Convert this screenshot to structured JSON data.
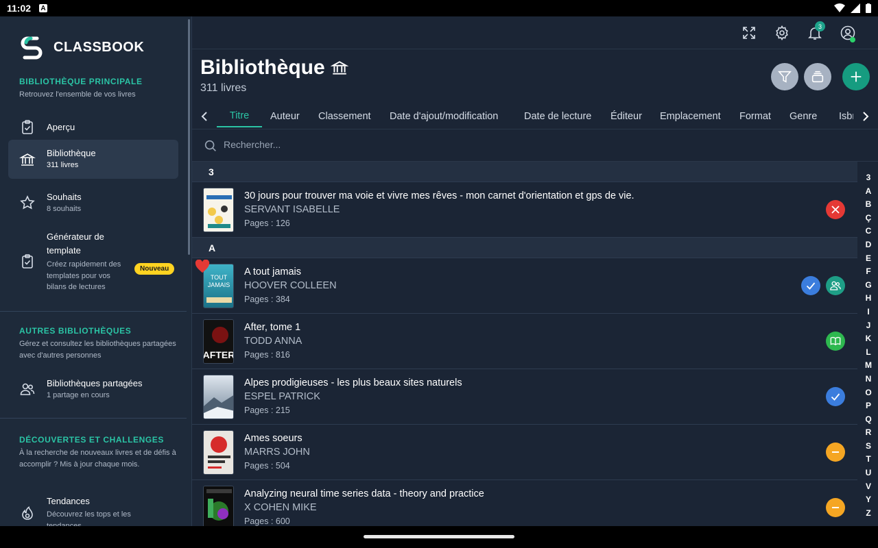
{
  "status_bar": {
    "time": "11:02",
    "notification_icon": "A"
  },
  "app": {
    "name": "CLASSBOOK"
  },
  "sidebar": {
    "main_section": {
      "title": "BIBLIOTHÈQUE PRINCIPALE",
      "subtitle": "Retrouvez l'ensemble de vos livres"
    },
    "items": [
      {
        "label": "Aperçu",
        "icon": "clipboard-check-icon"
      },
      {
        "label": "Bibliothèque",
        "desc": "311 livres",
        "icon": "library-icon",
        "active": true
      },
      {
        "label": "Souhaits",
        "desc": "8 souhaits",
        "icon": "star-icon"
      },
      {
        "label": "Générateur de template",
        "desc": "Créez rapidement des templates pour vos bilans de lectures",
        "icon": "clipboard-check-icon",
        "badge": "Nouveau"
      }
    ],
    "other_section": {
      "title": "AUTRES BIBLIOTHÈQUES",
      "subtitle": "Gérez et consultez les bibliothèques partagées avec d'autres personnes"
    },
    "shared": {
      "label": "Bibliothèques partagées",
      "desc": "1 partage en cours",
      "icon": "users-icon"
    },
    "discover_section": {
      "title": "DÉCOUVERTES ET CHALLENGES",
      "subtitle": "À la recherche de nouveaux livres et de défis à accomplir ? Mis à jour chaque mois."
    },
    "trends": {
      "label": "Tendances",
      "desc": "Découvrez les tops et les tendances",
      "icon": "flame-icon"
    }
  },
  "topbar": {
    "notification_count": "3",
    "icons": [
      "fullscreen-icon",
      "gear-icon",
      "bell-icon",
      "account-icon"
    ]
  },
  "page": {
    "title": "Bibliothèque",
    "subtitle": "311 livres"
  },
  "tabs": [
    "Titre",
    "Auteur",
    "Classement",
    "Date d'ajout/modification",
    "Date de lecture",
    "Éditeur",
    "Emplacement",
    "Format",
    "Genre",
    "Isbn"
  ],
  "active_tab": "Titre",
  "search": {
    "placeholder": "Rechercher..."
  },
  "sections": [
    {
      "letter": "3",
      "books": [
        {
          "title": "30 jours pour trouver ma voie et vivre mes rêves - mon carnet d'orientation et gps de vie.",
          "author": "SERVANT ISABELLE",
          "pages": "Pages : 126",
          "statuses": [
            "abandoned"
          ],
          "favorite": false
        }
      ]
    },
    {
      "letter": "A",
      "books": [
        {
          "title": "A tout jamais",
          "author": "HOOVER COLLEEN",
          "pages": "Pages : 384",
          "statuses": [
            "read",
            "lent"
          ],
          "favorite": true
        },
        {
          "title": "After, tome 1",
          "author": "TODD ANNA",
          "pages": "Pages : 816",
          "statuses": [
            "reading"
          ],
          "favorite": false
        },
        {
          "title": "Alpes prodigieuses - les plus beaux sites naturels",
          "author": "ESPEL PATRICK",
          "pages": "Pages : 215",
          "statuses": [
            "read"
          ],
          "favorite": false
        },
        {
          "title": "Ames soeurs",
          "author": "MARRS JOHN",
          "pages": "Pages : 504",
          "statuses": [
            "paused"
          ],
          "favorite": false
        },
        {
          "title": "Analyzing neural time series data - theory and practice",
          "author": "X COHEN MIKE",
          "pages": "Pages : 600",
          "statuses": [
            "paused"
          ],
          "favorite": false
        }
      ]
    }
  ],
  "alphabet": [
    "3",
    "A",
    "B",
    "Ç",
    "C",
    "D",
    "E",
    "F",
    "G",
    "H",
    "I",
    "J",
    "K",
    "L",
    "M",
    "N",
    "O",
    "P",
    "Q",
    "R",
    "S",
    "T",
    "U",
    "V",
    "Y",
    "Z"
  ],
  "colors": {
    "accent": "#2bc4a5",
    "abandoned": "#e53935",
    "read": "#3b7ddd",
    "lent": "#1e9e86",
    "reading": "#2eb84f",
    "paused": "#f5a623"
  }
}
